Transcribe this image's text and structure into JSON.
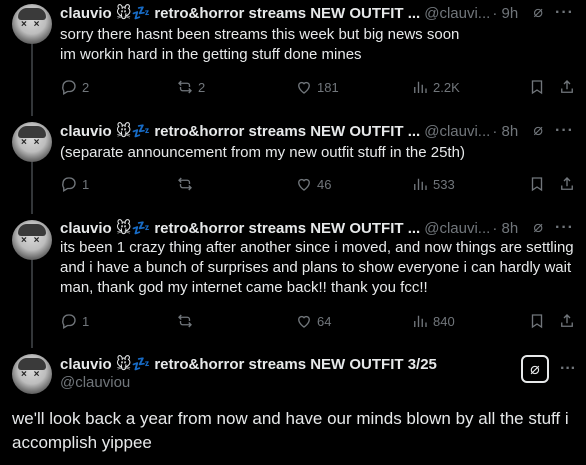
{
  "tweets": [
    {
      "name": "clauvio 🐭💤 retro&horror streams NEW OUTFIT ...",
      "handle": "@clauvi...",
      "time": "· 9h",
      "text": "sorry there hasnt been streams this week but big news soon\nim workin hard in the getting stuff done mines",
      "replies": "2",
      "reposts": "2",
      "likes": "181",
      "views": "2.2K"
    },
    {
      "name": "clauvio 🐭💤 retro&horror streams NEW OUTFIT ...",
      "handle": "@clauvi...",
      "time": "· 8h",
      "text": "(separate announcement from my new outfit stuff in the 25th)",
      "replies": "1",
      "reposts": "",
      "likes": "46",
      "views": "533"
    },
    {
      "name": "clauvio 🐭💤 retro&horror streams NEW OUTFIT ...",
      "handle": "@clauvi...",
      "time": "· 8h",
      "text": "its been 1 crazy thing after another since i moved, and now things are settling and i have a bunch of surprises and plans to show everyone i can hardly wait man, thank god my internet came back!! thank you fcc!!",
      "replies": "1",
      "reposts": "",
      "likes": "64",
      "views": "840"
    }
  ],
  "main": {
    "name": "clauvio 🐭💤 retro&horror streams NEW OUTFIT 3/25",
    "handle": "@clauviou",
    "text": "we'll look back a year from now and have our minds blown by all the stuff i accomplish yippee"
  },
  "icons": {
    "grok": "grok-icon",
    "more": "more-icon",
    "reply": "reply-icon",
    "repost": "repost-icon",
    "like": "like-icon",
    "views": "views-icon",
    "bookmark": "bookmark-icon",
    "share": "share-icon"
  },
  "colors": {
    "background": "#000000",
    "text": "#e7e9ea",
    "secondary": "#71767b",
    "thread_line": "#333639"
  }
}
